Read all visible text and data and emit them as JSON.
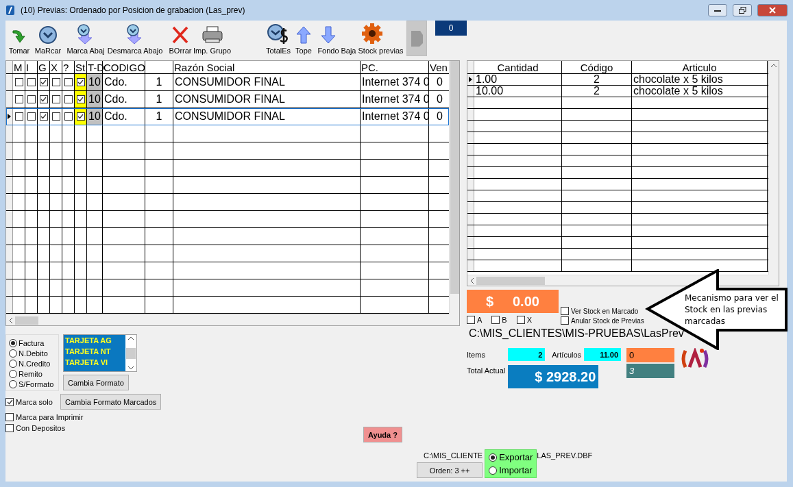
{
  "window": {
    "title": "(10) Previas: Ordenado por Posicion de grabacion (Las_prev)"
  },
  "toolbar": [
    {
      "label": "Tomar",
      "kind": "take"
    },
    {
      "label": "MaRcar",
      "kind": "mark"
    },
    {
      "label": "Marca Abaj",
      "kind": "markdown"
    },
    {
      "label": "Desmarca Abajo",
      "kind": "unmarkdown"
    },
    {
      "label": "BOrrar",
      "kind": "delete"
    },
    {
      "label": "Imp. Grupo",
      "kind": "print"
    },
    {
      "label": "TotalEs",
      "kind": "totals"
    },
    {
      "label": "Tope",
      "kind": "top"
    },
    {
      "label": "Fondo",
      "kind": "bottom"
    },
    {
      "label": "Baja Stock previas",
      "kind": "gear"
    }
  ],
  "counter": "0",
  "previas": {
    "columns": [
      "M",
      "I",
      "G",
      "X",
      "?",
      "St",
      "T-D",
      "CODIGO",
      "Razón Social",
      "PC.",
      "Ven"
    ],
    "rows": [
      {
        "selected": false,
        "checks": [
          false,
          false,
          true,
          false,
          false
        ],
        "st": true,
        "td": "10",
        "codigo": "Cdo.",
        "column_9": "1",
        "razon_social": "CONSUMIDOR FINAL",
        "pc": "Internet 374 0",
        "venc": "0"
      },
      {
        "selected": false,
        "checks": [
          false,
          false,
          true,
          false,
          false
        ],
        "st": true,
        "td": "10",
        "codigo": "Cdo.",
        "column_9": "1",
        "razon_social": "CONSUMIDOR FINAL",
        "pc": "Internet 374 0",
        "venc": "0"
      },
      {
        "selected": true,
        "checks": [
          false,
          false,
          true,
          false,
          false
        ],
        "st": true,
        "td": "10",
        "codigo": "Cdo.",
        "column_9": "1",
        "razon_social": "CONSUMIDOR FINAL",
        "pc": "Internet 374 0",
        "venc": "0"
      }
    ]
  },
  "detalle": {
    "columns": [
      "Cantidad",
      "Código",
      "Articulo"
    ],
    "rows": [
      {
        "selected": true,
        "cantidad": "1.00",
        "codigo": "2",
        "articulo": "chocolate x 5 kilos"
      },
      {
        "selected": false,
        "cantidad": "10.00",
        "codigo": "2",
        "articulo": "chocolate x 5 kilos"
      }
    ]
  },
  "saldo": "$     0.00",
  "filtros": [
    {
      "label": "A",
      "checked": false
    },
    {
      "label": "B",
      "checked": false
    },
    {
      "label": "X",
      "checked": false
    }
  ],
  "stock_options": [
    {
      "label": "Ver Stock en Marcado",
      "checked": false
    },
    {
      "label": "Anular Stock de Previas",
      "checked": false
    }
  ],
  "folder_path": "C:\\MIS_CLIENTES\\MIS-PRUEBAS\\LasPrev",
  "callout": "Mecanismo para ver el Stock en las previas marcadas",
  "totals": {
    "items_label": "Items",
    "items": "2",
    "articulos_label": "Artículos",
    "articulos": "11.00",
    "orange_value": "0",
    "teal_value": "3",
    "total_label": "Total Actual",
    "total": "$ 2928.20"
  },
  "formatos": [
    {
      "label": "Factura",
      "selected": true
    },
    {
      "label": "N.Debito",
      "selected": false
    },
    {
      "label": "N.Credito",
      "selected": false
    },
    {
      "label": "Remito",
      "selected": false
    },
    {
      "label": "S/Formato",
      "selected": false
    }
  ],
  "tarjetas": [
    "TARJETA AG",
    "TARJETA NT",
    "TARJETA VI"
  ],
  "buttons": {
    "cambia_formato": "Cambia Formato",
    "cambia_marcados": "Cambia Formato Marcados",
    "ayuda": "Ayuda ?",
    "orden": "Orden: 3 ++"
  },
  "options": [
    {
      "label": "Marca solo",
      "checked": true
    },
    {
      "label": "Marca para Imprimir",
      "checked": false
    },
    {
      "label": "Con Depositos",
      "checked": false
    }
  ],
  "dbf_path_start": "C:\\MIS_CLIENTE",
  "dbf_path_end": "LAS_PREV.DBF",
  "transfer": [
    {
      "label": "Exportar",
      "selected": true
    },
    {
      "label": "Importar",
      "selected": false
    }
  ]
}
